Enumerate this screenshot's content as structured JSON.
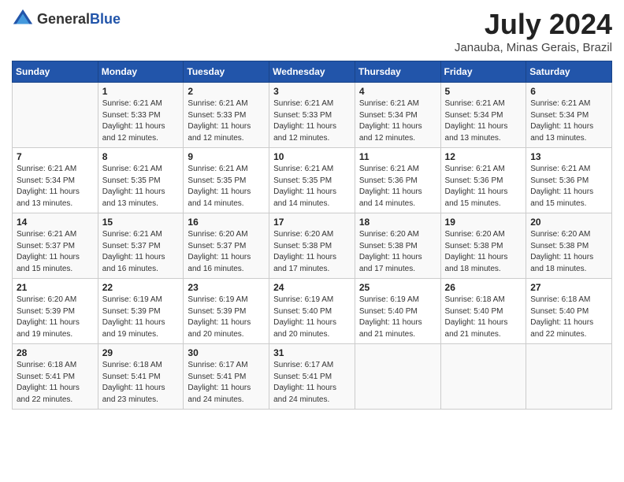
{
  "header": {
    "logo_general": "General",
    "logo_blue": "Blue",
    "main_title": "July 2024",
    "subtitle": "Janauba, Minas Gerais, Brazil"
  },
  "days_of_week": [
    "Sunday",
    "Monday",
    "Tuesday",
    "Wednesday",
    "Thursday",
    "Friday",
    "Saturday"
  ],
  "weeks": [
    [
      {
        "day": "",
        "info": ""
      },
      {
        "day": "1",
        "info": "Sunrise: 6:21 AM\nSunset: 5:33 PM\nDaylight: 11 hours\nand 12 minutes."
      },
      {
        "day": "2",
        "info": "Sunrise: 6:21 AM\nSunset: 5:33 PM\nDaylight: 11 hours\nand 12 minutes."
      },
      {
        "day": "3",
        "info": "Sunrise: 6:21 AM\nSunset: 5:33 PM\nDaylight: 11 hours\nand 12 minutes."
      },
      {
        "day": "4",
        "info": "Sunrise: 6:21 AM\nSunset: 5:34 PM\nDaylight: 11 hours\nand 12 minutes."
      },
      {
        "day": "5",
        "info": "Sunrise: 6:21 AM\nSunset: 5:34 PM\nDaylight: 11 hours\nand 13 minutes."
      },
      {
        "day": "6",
        "info": "Sunrise: 6:21 AM\nSunset: 5:34 PM\nDaylight: 11 hours\nand 13 minutes."
      }
    ],
    [
      {
        "day": "7",
        "info": "Sunrise: 6:21 AM\nSunset: 5:34 PM\nDaylight: 11 hours\nand 13 minutes."
      },
      {
        "day": "8",
        "info": "Sunrise: 6:21 AM\nSunset: 5:35 PM\nDaylight: 11 hours\nand 13 minutes."
      },
      {
        "day": "9",
        "info": "Sunrise: 6:21 AM\nSunset: 5:35 PM\nDaylight: 11 hours\nand 14 minutes."
      },
      {
        "day": "10",
        "info": "Sunrise: 6:21 AM\nSunset: 5:35 PM\nDaylight: 11 hours\nand 14 minutes."
      },
      {
        "day": "11",
        "info": "Sunrise: 6:21 AM\nSunset: 5:36 PM\nDaylight: 11 hours\nand 14 minutes."
      },
      {
        "day": "12",
        "info": "Sunrise: 6:21 AM\nSunset: 5:36 PM\nDaylight: 11 hours\nand 15 minutes."
      },
      {
        "day": "13",
        "info": "Sunrise: 6:21 AM\nSunset: 5:36 PM\nDaylight: 11 hours\nand 15 minutes."
      }
    ],
    [
      {
        "day": "14",
        "info": "Sunrise: 6:21 AM\nSunset: 5:37 PM\nDaylight: 11 hours\nand 15 minutes."
      },
      {
        "day": "15",
        "info": "Sunrise: 6:21 AM\nSunset: 5:37 PM\nDaylight: 11 hours\nand 16 minutes."
      },
      {
        "day": "16",
        "info": "Sunrise: 6:20 AM\nSunset: 5:37 PM\nDaylight: 11 hours\nand 16 minutes."
      },
      {
        "day": "17",
        "info": "Sunrise: 6:20 AM\nSunset: 5:38 PM\nDaylight: 11 hours\nand 17 minutes."
      },
      {
        "day": "18",
        "info": "Sunrise: 6:20 AM\nSunset: 5:38 PM\nDaylight: 11 hours\nand 17 minutes."
      },
      {
        "day": "19",
        "info": "Sunrise: 6:20 AM\nSunset: 5:38 PM\nDaylight: 11 hours\nand 18 minutes."
      },
      {
        "day": "20",
        "info": "Sunrise: 6:20 AM\nSunset: 5:38 PM\nDaylight: 11 hours\nand 18 minutes."
      }
    ],
    [
      {
        "day": "21",
        "info": "Sunrise: 6:20 AM\nSunset: 5:39 PM\nDaylight: 11 hours\nand 19 minutes."
      },
      {
        "day": "22",
        "info": "Sunrise: 6:19 AM\nSunset: 5:39 PM\nDaylight: 11 hours\nand 19 minutes."
      },
      {
        "day": "23",
        "info": "Sunrise: 6:19 AM\nSunset: 5:39 PM\nDaylight: 11 hours\nand 20 minutes."
      },
      {
        "day": "24",
        "info": "Sunrise: 6:19 AM\nSunset: 5:40 PM\nDaylight: 11 hours\nand 20 minutes."
      },
      {
        "day": "25",
        "info": "Sunrise: 6:19 AM\nSunset: 5:40 PM\nDaylight: 11 hours\nand 21 minutes."
      },
      {
        "day": "26",
        "info": "Sunrise: 6:18 AM\nSunset: 5:40 PM\nDaylight: 11 hours\nand 21 minutes."
      },
      {
        "day": "27",
        "info": "Sunrise: 6:18 AM\nSunset: 5:40 PM\nDaylight: 11 hours\nand 22 minutes."
      }
    ],
    [
      {
        "day": "28",
        "info": "Sunrise: 6:18 AM\nSunset: 5:41 PM\nDaylight: 11 hours\nand 22 minutes."
      },
      {
        "day": "29",
        "info": "Sunrise: 6:18 AM\nSunset: 5:41 PM\nDaylight: 11 hours\nand 23 minutes."
      },
      {
        "day": "30",
        "info": "Sunrise: 6:17 AM\nSunset: 5:41 PM\nDaylight: 11 hours\nand 24 minutes."
      },
      {
        "day": "31",
        "info": "Sunrise: 6:17 AM\nSunset: 5:41 PM\nDaylight: 11 hours\nand 24 minutes."
      },
      {
        "day": "",
        "info": ""
      },
      {
        "day": "",
        "info": ""
      },
      {
        "day": "",
        "info": ""
      }
    ]
  ]
}
